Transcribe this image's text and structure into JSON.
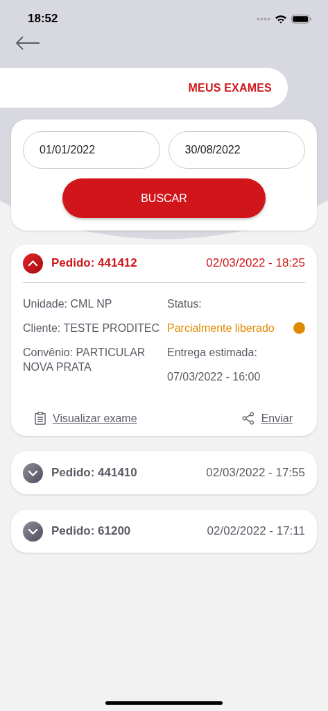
{
  "status_bar": {
    "time": "18:52"
  },
  "header": {
    "title": "MEUS EXAMES"
  },
  "search": {
    "start_date": "01/01/2022",
    "end_date": "30/08/2022",
    "button": "BUSCAR"
  },
  "orders": [
    {
      "title": "Pedido: 441412",
      "datetime": "02/03/2022 - 18:25",
      "expanded": true,
      "details_left": [
        {
          "label": "Unidade:",
          "value": "CML NP"
        },
        {
          "label": "Cliente:",
          "value": "TESTE PRODITEC"
        },
        {
          "label": "Convênio:",
          "value": "PARTICULAR NOVA PRATA"
        }
      ],
      "status_label": "Status:",
      "status": {
        "text": "Parcialmente liberado",
        "color": "#e08a00"
      },
      "delivery_label": "Entrega estimada:",
      "delivery": "07/03/2022 - 16:00",
      "actions": [
        "Visualizar exame",
        "Enviar"
      ]
    },
    {
      "title": "Pedido: 441410",
      "datetime": "02/03/2022 - 17:55",
      "expanded": false
    },
    {
      "title": "Pedido: 61200",
      "datetime": "02/02/2022 - 17:11",
      "expanded": false
    }
  ]
}
